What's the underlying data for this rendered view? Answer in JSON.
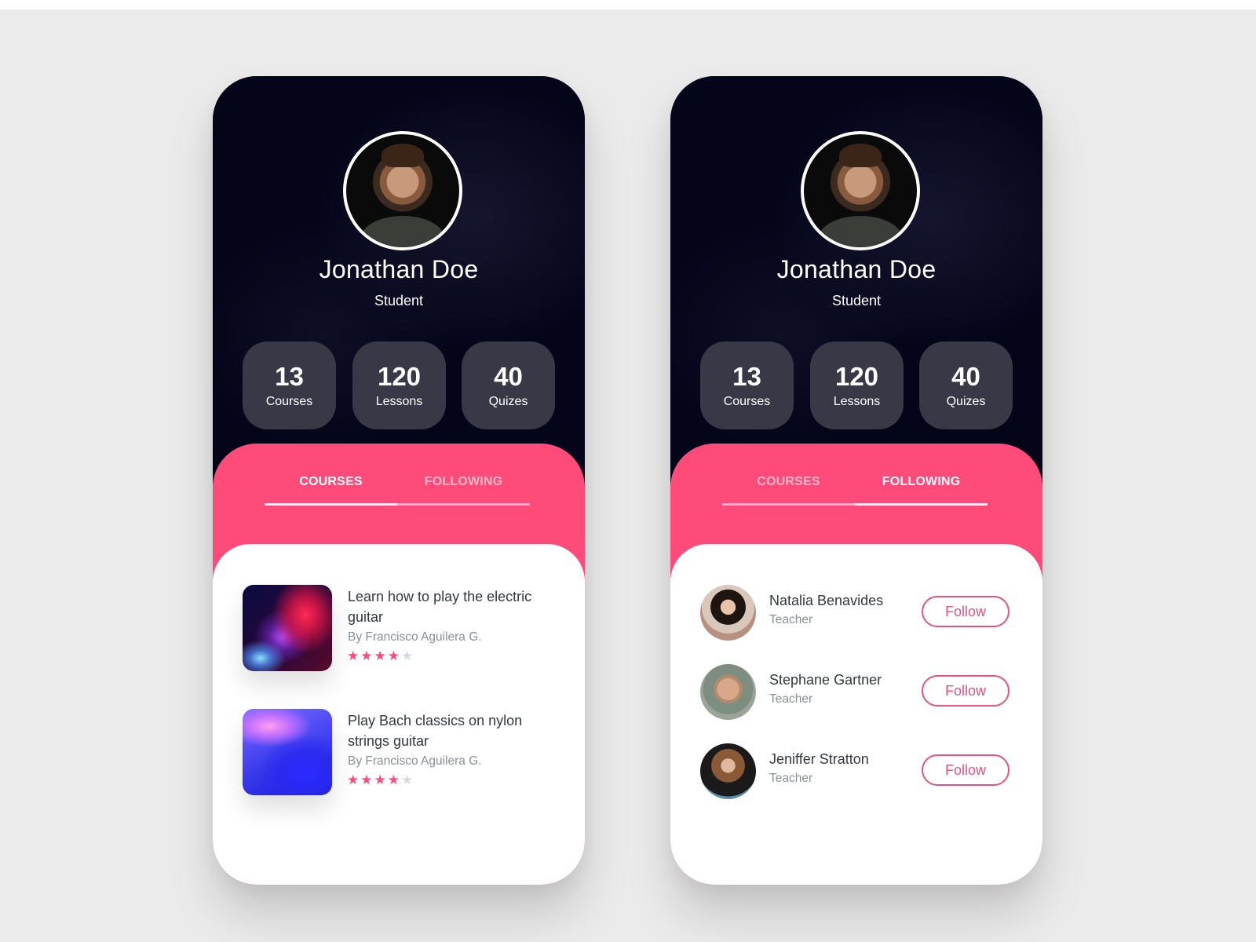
{
  "colors": {
    "background": "#ebebeb",
    "card_dark": "#05051a",
    "stat_tile": "#383847",
    "accent_pink": "#ff4b7a",
    "star_on": "#ff4b7a",
    "star_off": "#d6dadd"
  },
  "screens": [
    {
      "profile": {
        "name": "Jonathan Doe",
        "role": "Student"
      },
      "stats": [
        {
          "value": "13",
          "label": "Courses"
        },
        {
          "value": "120",
          "label": "Lessons"
        },
        {
          "value": "40",
          "label": "Quizes"
        }
      ],
      "tabs": [
        {
          "label": "COURSES",
          "active": true
        },
        {
          "label": "FOLLOWING",
          "active": false
        }
      ],
      "courses": [
        {
          "title": "Learn how to play the electric guitar",
          "author": "By Francisco Aguilera G.",
          "rating": 4,
          "rating_max": 5,
          "thumbnail": "abstract-red-blue-light-image"
        },
        {
          "title": "Play Bach classics on nylon strings guitar",
          "author": "By Francisco Aguilera G.",
          "rating": 4,
          "rating_max": 5,
          "thumbnail": "abstract-blue-purple-wave-image"
        }
      ]
    },
    {
      "profile": {
        "name": "Jonathan Doe",
        "role": "Student"
      },
      "stats": [
        {
          "value": "13",
          "label": "Courses"
        },
        {
          "value": "120",
          "label": "Lessons"
        },
        {
          "value": "40",
          "label": "Quizes"
        }
      ],
      "tabs": [
        {
          "label": "COURSES",
          "active": false
        },
        {
          "label": "FOLLOWING",
          "active": true
        }
      ],
      "following": [
        {
          "name": "Natalia Benavides",
          "role": "Teacher",
          "button": "Follow"
        },
        {
          "name": "Stephane Gartner",
          "role": "Teacher",
          "button": "Follow"
        },
        {
          "name": "Jeniffer Stratton",
          "role": "Teacher",
          "button": "Follow"
        }
      ]
    }
  ]
}
